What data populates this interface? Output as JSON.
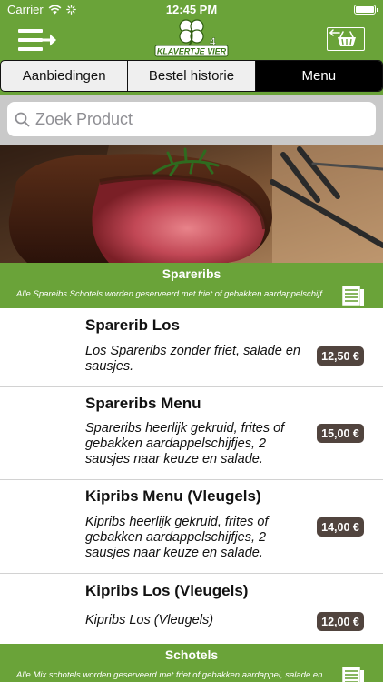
{
  "status_bar": {
    "carrier": "Carrier",
    "time": "12:45 PM",
    "battery_level": 1.0
  },
  "navbar": {
    "menu_icon": "menu-arrow-icon",
    "logo_text": "KLAVERTJE VIER",
    "cart_icon": "basket-back-icon"
  },
  "tabs": [
    {
      "label": "Aanbiedingen",
      "active": false
    },
    {
      "label": "Bestel historie",
      "active": false
    },
    {
      "label": "Menu",
      "active": true
    }
  ],
  "search": {
    "placeholder": "Zoek Product"
  },
  "categories": [
    {
      "title": "Spareribs",
      "description": "Alle Spareibs Schotels worden geserveerd met friet of gebakken aardappelschijfjes"
    },
    {
      "title": "Schotels",
      "description": "Alle Mix schotels worden geserveerd met friet of gebakken aardappel, salade en sausjes"
    }
  ],
  "products": [
    {
      "name": "Sparerib Los",
      "description": "Los Spareribs zonder friet, salade en sausjes.",
      "price": "12,50 €"
    },
    {
      "name": "Spareribs Menu",
      "description": "Spareribs heerlijk gekruid, frites of gebakken aardappelschijfjes, 2 sausjes naar keuze en salade.",
      "price": "15,00 €"
    },
    {
      "name": "Kipribs Menu (Vleugels)",
      "description": "Kipribs heerlijk gekruid, frites of gebakken aardappelschijfjes, 2 sausjes naar keuze en salade.",
      "price": "14,00 €"
    },
    {
      "name": "Kipribs Los (Vleugels)",
      "description": "Kipribs Los (Vleugels)",
      "price": "12,00 €"
    }
  ],
  "colors": {
    "brand_green": "#6aa339",
    "price_badge": "#51443e",
    "active_tab": "#000000"
  }
}
